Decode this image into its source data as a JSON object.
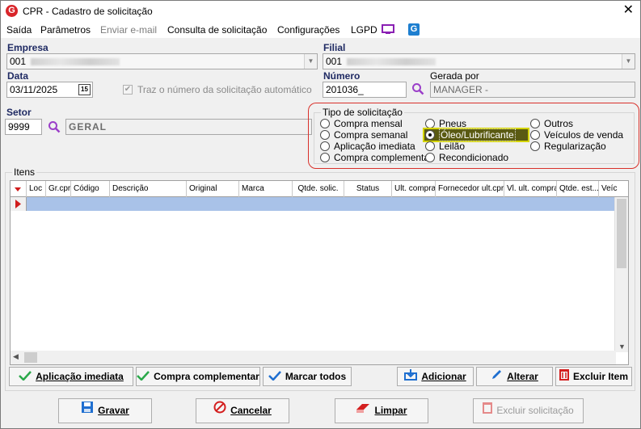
{
  "window": {
    "title": "CPR - Cadastro de solicitação"
  },
  "menu": {
    "items": [
      {
        "label": "Saída",
        "disabled": false
      },
      {
        "label": "Parâmetros",
        "disabled": false
      },
      {
        "label": "Enviar e-mail",
        "disabled": true
      },
      {
        "label": "Consulta de solicitação",
        "disabled": false
      },
      {
        "label": "Configurações",
        "disabled": false
      },
      {
        "label": "LGPD",
        "disabled": false
      }
    ]
  },
  "form": {
    "empresa": {
      "label": "Empresa",
      "value": "001"
    },
    "filial": {
      "label": "Filial",
      "value": "001"
    },
    "data": {
      "label": "Data",
      "value": "03/11/2025",
      "calendar_day": "15"
    },
    "auto_number": {
      "label": "Traz o número da solicitação automático",
      "checked": true
    },
    "numero": {
      "label": "Número",
      "value": "201036_"
    },
    "gerada_por": {
      "label": "Gerada por",
      "value": "MANAGER -"
    },
    "setor": {
      "label": "Setor",
      "code": "9999",
      "name": "GERAL"
    }
  },
  "tipo_solicitacao": {
    "title": "Tipo de solicitação",
    "col1": [
      "Compra mensal",
      "Compra semanal",
      "Aplicação imediata",
      "Compra complementar"
    ],
    "col2": [
      "Pneus",
      "Óleo/Lubrificante",
      "Leilão",
      "Recondicionado"
    ],
    "col3": [
      "Outros",
      "Veículos de venda",
      "Regularização"
    ],
    "selected": "Óleo/Lubrificante"
  },
  "itens": {
    "title": "Itens",
    "columns": [
      "Loc",
      "Gr.cpr",
      "Código",
      "Descrição",
      "Original",
      "Marca",
      "Qtde. solic.",
      "Status",
      "Ult. compra",
      "Fornecedor ult.cpr",
      "Vl. ult. compra",
      "Qtde. est...",
      "Veíc"
    ]
  },
  "item_buttons": {
    "aplicacao_imediata": "Aplicação imediata",
    "compra_complementar": "Compra complementar",
    "marcar_todos": "Marcar todos",
    "adicionar": "Adicionar",
    "alterar": "Alterar",
    "excluir_item": "Excluir Item"
  },
  "footer_buttons": {
    "gravar": "Gravar",
    "cancelar": "Cancelar",
    "limpar": "Limpar",
    "excluir_solicitacao": "Excluir solicitação"
  },
  "colors": {
    "accent": "#1f2a63",
    "selection_row": "#a9c2e8",
    "highlight_border": "#d4d400",
    "highlight_fill": "#5a5a12",
    "red_outline": "#d9302a"
  }
}
